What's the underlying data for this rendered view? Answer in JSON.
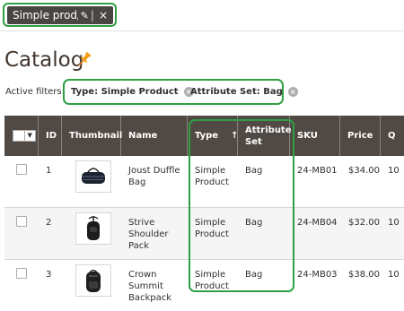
{
  "saved_view": {
    "name": "Simple prod/bag",
    "edit_icon": "pencil-icon",
    "close_icon": "close-icon"
  },
  "page": {
    "title": "Catalog",
    "pin_icon": "pin-icon",
    "accent_color": "#f39c12"
  },
  "active_filters": {
    "label": "Active filters:",
    "filters": [
      {
        "label": "Type: Simple Product",
        "remove_icon": "remove-icon"
      },
      {
        "label": "Attribute Set: Bag",
        "remove_icon": "remove-icon"
      }
    ]
  },
  "grid": {
    "columns": {
      "id": "ID",
      "thumbnail": "Thumbnail",
      "name": "Name",
      "type": "Type",
      "type_sort": "↑",
      "attribute_set": "Attribute Set",
      "sku": "SKU",
      "price": "Price",
      "quantity": "Q"
    },
    "rows": [
      {
        "id": "1",
        "name": "Joust Duffle Bag",
        "type": "Simple Product",
        "attribute_set": "Bag",
        "sku": "24-MB01",
        "price": "$34.00",
        "quantity": "10"
      },
      {
        "id": "2",
        "name": "Strive Shoulder Pack",
        "type": "Simple Product",
        "attribute_set": "Bag",
        "sku": "24-MB04",
        "price": "$32.00",
        "quantity": "10"
      },
      {
        "id": "3",
        "name": "Crown Summit Backpack",
        "type": "Simple Product",
        "attribute_set": "Bag",
        "sku": "24-MB03",
        "price": "$38.00",
        "quantity": "10"
      }
    ]
  },
  "colors": {
    "header_bg": "#514943",
    "highlight": "#2ea043"
  }
}
